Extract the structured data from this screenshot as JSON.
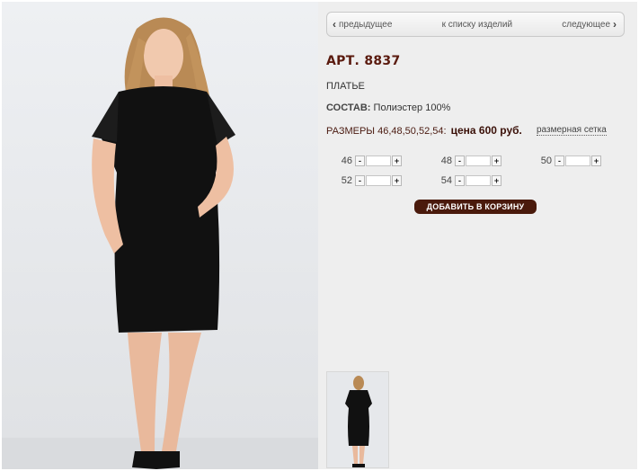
{
  "nav": {
    "prev_label": "предыдущее",
    "list_label": "к списку изделий",
    "next_label": "следующее"
  },
  "product": {
    "article": "АРТ. 8837",
    "type": "ПЛАТЬЕ",
    "composition_label": "СОСТАВ:",
    "composition_value": " Полиэстер 100%",
    "sizes_text": "РАЗМЕРЫ 46,48,50,52,54:",
    "price": "цена 600 руб.",
    "size_chart_label": "размерная сетка"
  },
  "quantity": {
    "sizes": [
      "46",
      "48",
      "50",
      "52",
      "54"
    ],
    "minus": "-",
    "plus": "+"
  },
  "cart": {
    "add_label": "ДОБАВИТЬ В КОРЗИНУ"
  },
  "colors": {
    "accent": "#4a1a0c",
    "panel_bg": "#eeeeee"
  }
}
